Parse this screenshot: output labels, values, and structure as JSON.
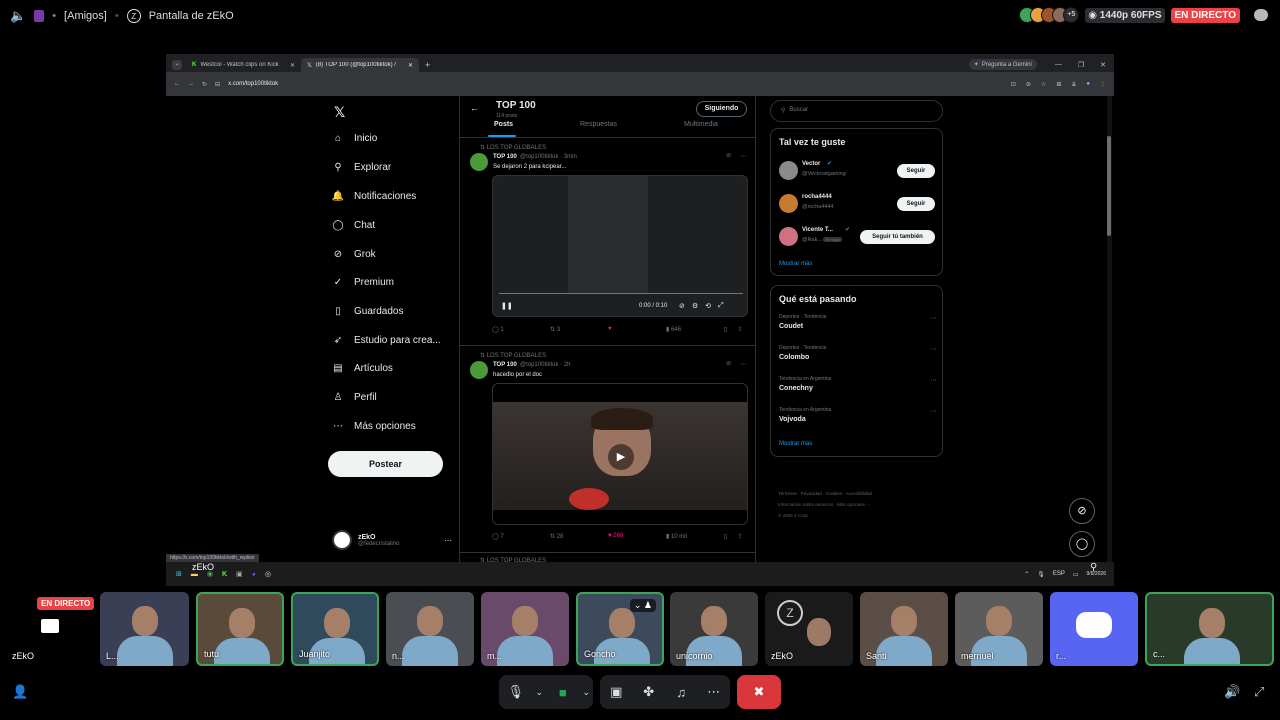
{
  "topbar": {
    "channel": "[Amigos]",
    "screen_share_title": "Pantalla de zEkO",
    "extra_count": "+5",
    "quality": "1440p 60FPS",
    "live_label": "EN DIRECTO"
  },
  "browser": {
    "tabs": [
      {
        "label": "Westcol - Watch clips on Kick"
      },
      {
        "label": "(8) TOP 100 (@top100tiktok) /"
      }
    ],
    "gemini_label": "Pregunta a Gemini",
    "url": "x.com/top100tiktok"
  },
  "x_nav": {
    "items": [
      {
        "label": "Inicio",
        "icon": "home-icon",
        "glyph": "⌂"
      },
      {
        "label": "Explorar",
        "icon": "search-icon",
        "glyph": "⚲"
      },
      {
        "label": "Notificaciones",
        "icon": "bell-icon",
        "glyph": "🔔"
      },
      {
        "label": "Chat",
        "icon": "chat-icon",
        "glyph": "◯"
      },
      {
        "label": "Grok",
        "icon": "grok-icon",
        "glyph": "⊘"
      },
      {
        "label": "Premium",
        "icon": "premium-icon",
        "glyph": "✓"
      },
      {
        "label": "Guardados",
        "icon": "bookmark-icon",
        "glyph": "▯"
      },
      {
        "label": "Estudio para crea...",
        "icon": "rocket-icon",
        "glyph": "➶"
      },
      {
        "label": "Artículos",
        "icon": "article-icon",
        "glyph": "▤"
      },
      {
        "label": "Perfil",
        "icon": "profile-icon",
        "glyph": "♙"
      },
      {
        "label": "Más opciones",
        "icon": "more-options-icon",
        "glyph": "⋯"
      }
    ],
    "post_button": "Postear",
    "account_name": "zEkO",
    "account_handle": "@fedecristalino"
  },
  "profile": {
    "name": "TOP 100",
    "post_count": "114 posts",
    "follow_state": "Siguiendo",
    "tabs": [
      "Posts",
      "Respuestas",
      "Multimedia"
    ]
  },
  "posts": [
    {
      "context": "LOS TOP GLOBALES",
      "author": "TOP 100",
      "handle_time": "@top100tiktok · 3min",
      "text": "Se dejaron 2 para kcipear...",
      "video_time": "0:00 / 0:10",
      "stats": {
        "replies": "1",
        "reposts": "3",
        "likes": "",
        "views": "646"
      }
    },
    {
      "context": "LOS TOP GLOBALES",
      "author": "TOP 100",
      "handle_time": "@top100tiktok · 2h",
      "text": "hacedlo por el doc",
      "stats": {
        "replies": "7",
        "reposts": "28",
        "likes": "268",
        "views": "10 mil"
      }
    }
  ],
  "third_post_context": "LOS TOP GLOBALES",
  "right": {
    "search_placeholder": "Buscar",
    "suggest_title": "Tal vez te guste",
    "suggestions": [
      {
        "name": "Vector",
        "handle": "@Vectoratgaming",
        "button": "Seguir"
      },
      {
        "name": "rocha4444",
        "handle": "@rocha4444",
        "button": "Seguir"
      },
      {
        "name": "Vicente T...",
        "handle": "@Rak...",
        "badge": "Te sigue",
        "button": "Seguir tú también"
      }
    ],
    "show_more": "Mostrar más",
    "trends_title": "Qué está pasando",
    "trends": [
      {
        "context": "Deportes · Tendencia",
        "name": "Coudet"
      },
      {
        "context": "Deportes · Tendencia",
        "name": "Colombo"
      },
      {
        "context": "Tendencia en Argentina",
        "name": "Conechny"
      },
      {
        "context": "Tendencia en Argentina",
        "name": "Vojvoda"
      }
    ],
    "trends_more": "Mostrar más",
    "footer_line1": "Términos · Privacidad · Cookies · Accesibilidad ·",
    "footer_line2": "Información sobre anuncios · Más opciones ···",
    "footer_line3": "© 2026 X Corp."
  },
  "status_url": "https://x.com/top100tiktok/with_replies",
  "taskbar": {
    "user": "zEkO",
    "lang": "ESP",
    "date": "9/6/2026"
  },
  "participants": [
    {
      "name": "zEkO",
      "live": "EN DIRECTO",
      "bg": "#000000"
    },
    {
      "name": "L...",
      "bg": "#3a3f55"
    },
    {
      "name": "tutu",
      "bg": "#5a4a3a"
    },
    {
      "name": "Juanjito",
      "bg": "#2f4a5a"
    },
    {
      "name": "n...",
      "bg": "#4a4e52"
    },
    {
      "name": "m...",
      "bg": "#6a4a6a"
    },
    {
      "name": "Goncho",
      "bg": "#3c4a5c"
    },
    {
      "name": "unicornio",
      "bg": "#3a3a3a"
    },
    {
      "name": "zEkO",
      "bg": "#1a1a1a"
    },
    {
      "name": "Santi",
      "bg": "#5a4e46"
    },
    {
      "name": "mernuel",
      "bg": "#5c5c5c"
    },
    {
      "name": "r...",
      "bg": "#5865f2"
    },
    {
      "name": "c...",
      "bg": "#2a3a2a"
    }
  ]
}
